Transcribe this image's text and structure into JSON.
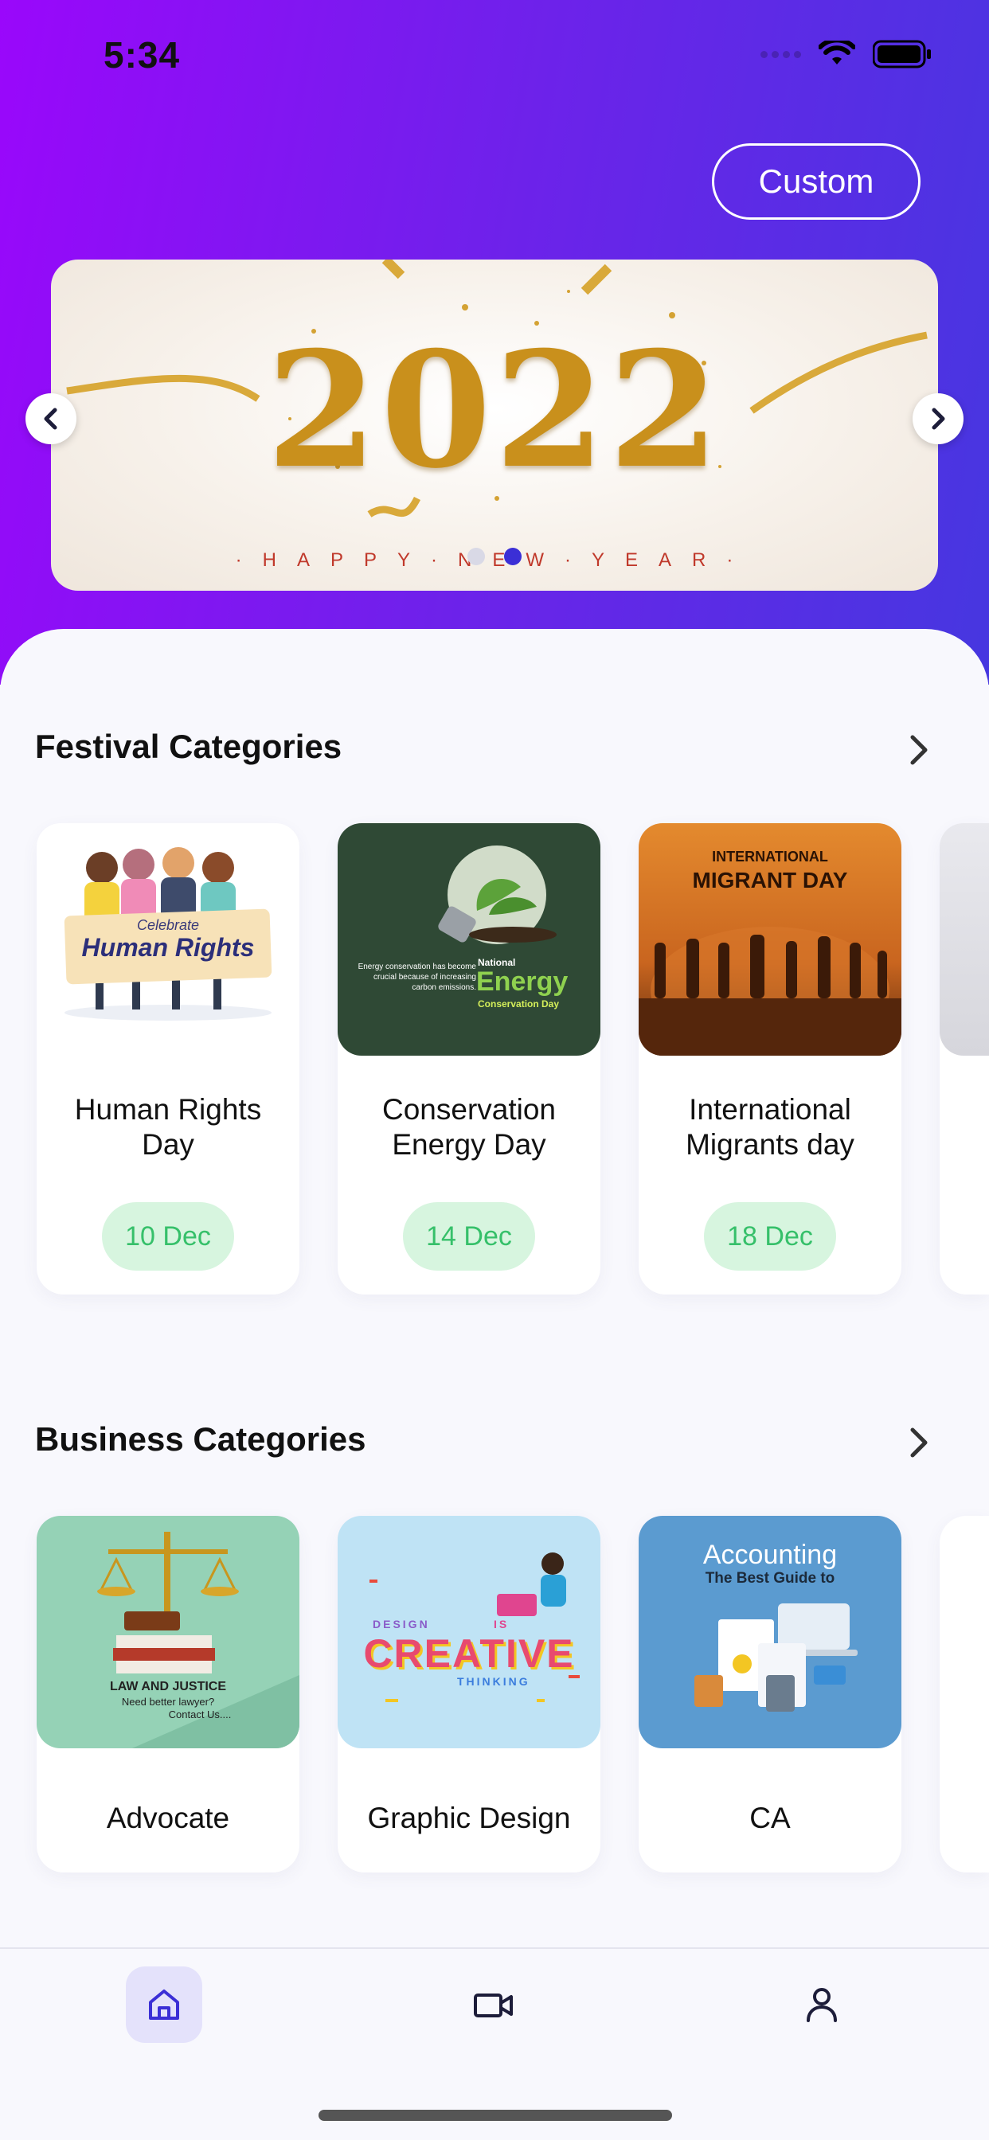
{
  "status_bar": {
    "time": "5:34"
  },
  "header": {
    "custom_label": "Custom"
  },
  "banner": {
    "headline": "2022",
    "caption": "·HAPPY·NEW·YEAR·",
    "slide_count": 2,
    "active_slide": 2
  },
  "festival": {
    "title": "Festival Categories",
    "items": [
      {
        "thumb_title": "Human Rights",
        "thumb_sub": "Celebrate",
        "label": "Human Rights Day",
        "date": "10 Dec"
      },
      {
        "thumb_title": "Energy",
        "thumb_sub": "National",
        "thumb_sub2": "Conservation Day",
        "thumb_note": "Energy conservation has become crucial because of increasing carbon emissions.",
        "label": "Conservation Energy Day",
        "date": "14 Dec"
      },
      {
        "thumb_title": "MIGRANT DAY",
        "thumb_sub": "INTERNATIONAL",
        "label": "International Migrants day",
        "date": "18 Dec"
      }
    ]
  },
  "business": {
    "title": "Business Categories",
    "items": [
      {
        "thumb_title": "LAW AND JUSTICE",
        "thumb_sub": "Need better lawyer?",
        "thumb_sub2": "Contact Us....",
        "label": "Advocate"
      },
      {
        "thumb_title": "CREATIVE",
        "thumb_sub": "DESIGN",
        "thumb_sub2": "IS",
        "thumb_sub3": "THINKING",
        "label": "Graphic Design"
      },
      {
        "thumb_title": "Accounting",
        "thumb_sub": "The Best Guide to",
        "label": "CA"
      }
    ]
  },
  "colors": {
    "accent": "#3b2fd6",
    "date_green": "#36c06a",
    "date_bg": "#d7f5df"
  },
  "tabs": [
    {
      "icon": "home-icon",
      "active": true
    },
    {
      "icon": "video-icon",
      "active": false
    },
    {
      "icon": "profile-icon",
      "active": false
    }
  ]
}
